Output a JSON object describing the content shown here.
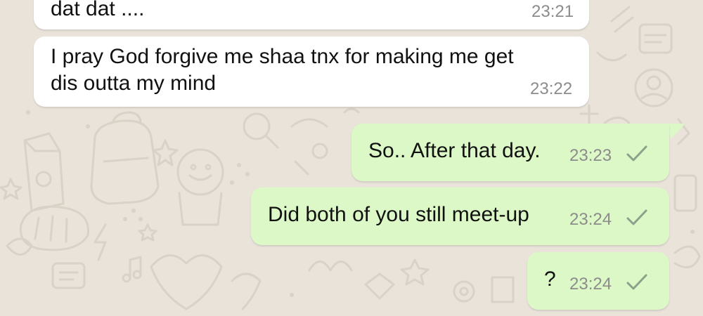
{
  "chat": {
    "background_color": "#e9e3da",
    "incoming_bubble_color": "#ffffff",
    "outgoing_bubble_color": "#dcf8c6",
    "tick_icon": "single-check-icon",
    "messages": [
      {
        "direction": "incoming",
        "lines": [
          "dat dat ...."
        ],
        "time": "23:21"
      },
      {
        "direction": "incoming",
        "lines": [
          "I pray God forgive me shaa tnx for making me get",
          "dis outta my mind"
        ],
        "time": "23:22"
      },
      {
        "direction": "outgoing",
        "lines": [
          "So.. After that day."
        ],
        "time": "23:23",
        "status": "sent"
      },
      {
        "direction": "outgoing",
        "lines": [
          "Did both of you still meet-up"
        ],
        "time": "23:24",
        "status": "sent"
      },
      {
        "direction": "outgoing",
        "lines": [
          "?"
        ],
        "time": "23:24",
        "status": "sent"
      }
    ]
  }
}
